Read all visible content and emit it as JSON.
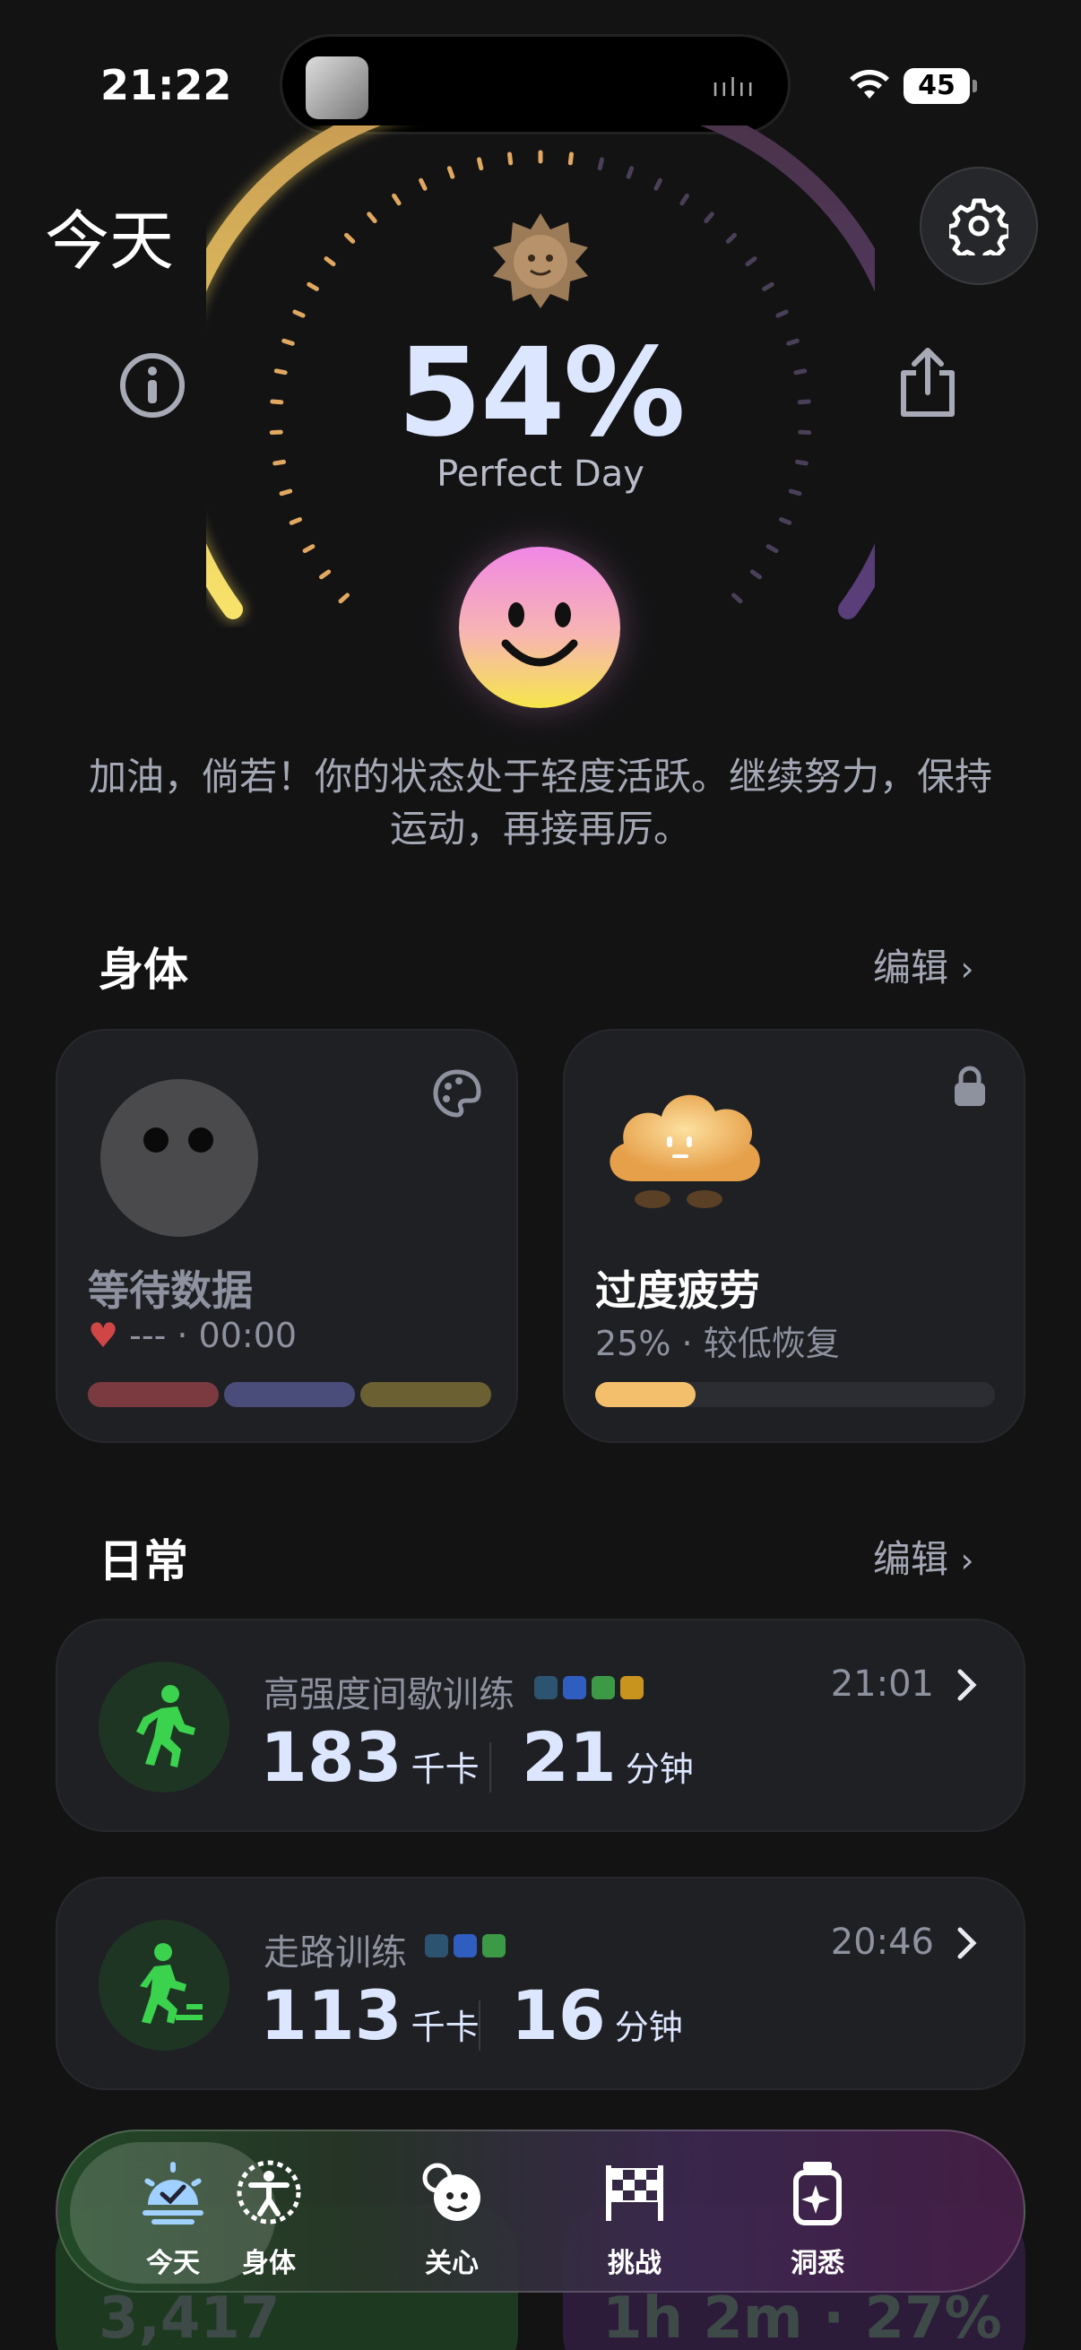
{
  "status_bar": {
    "time": "21:22",
    "battery": "45"
  },
  "header": {
    "title": "今天"
  },
  "score": {
    "value": "54%",
    "label": "Perfect Day",
    "fraction": 0.54
  },
  "message": "加油，倘若！你的状态处于轻度活跃。继续努力，保持运动，再接再厉。",
  "body_section": {
    "title": "身体",
    "edit_label": "编辑",
    "cards": [
      {
        "title": "等待数据",
        "subtitle": "--- · 00:00"
      },
      {
        "title": "过度疲劳",
        "subtitle": "25% · 较低恢复",
        "progress": 0.25
      }
    ]
  },
  "daily_section": {
    "title": "日常",
    "edit_label": "编辑",
    "activities": [
      {
        "name": "高强度间歇训练",
        "time": "21:01",
        "calories": "183",
        "calories_unit": "千卡",
        "minutes": "21",
        "minutes_unit": "分钟"
      },
      {
        "name": "走路训练",
        "time": "20:46",
        "calories": "113",
        "calories_unit": "千卡",
        "minutes": "16",
        "minutes_unit": "分钟"
      }
    ]
  },
  "peek": {
    "left": "3,417",
    "right": "1h 2m · 27%"
  },
  "tabs": [
    {
      "label": "今天"
    },
    {
      "label": "身体"
    },
    {
      "label": "关心"
    },
    {
      "label": "挑战"
    },
    {
      "label": "洞悉"
    }
  ]
}
